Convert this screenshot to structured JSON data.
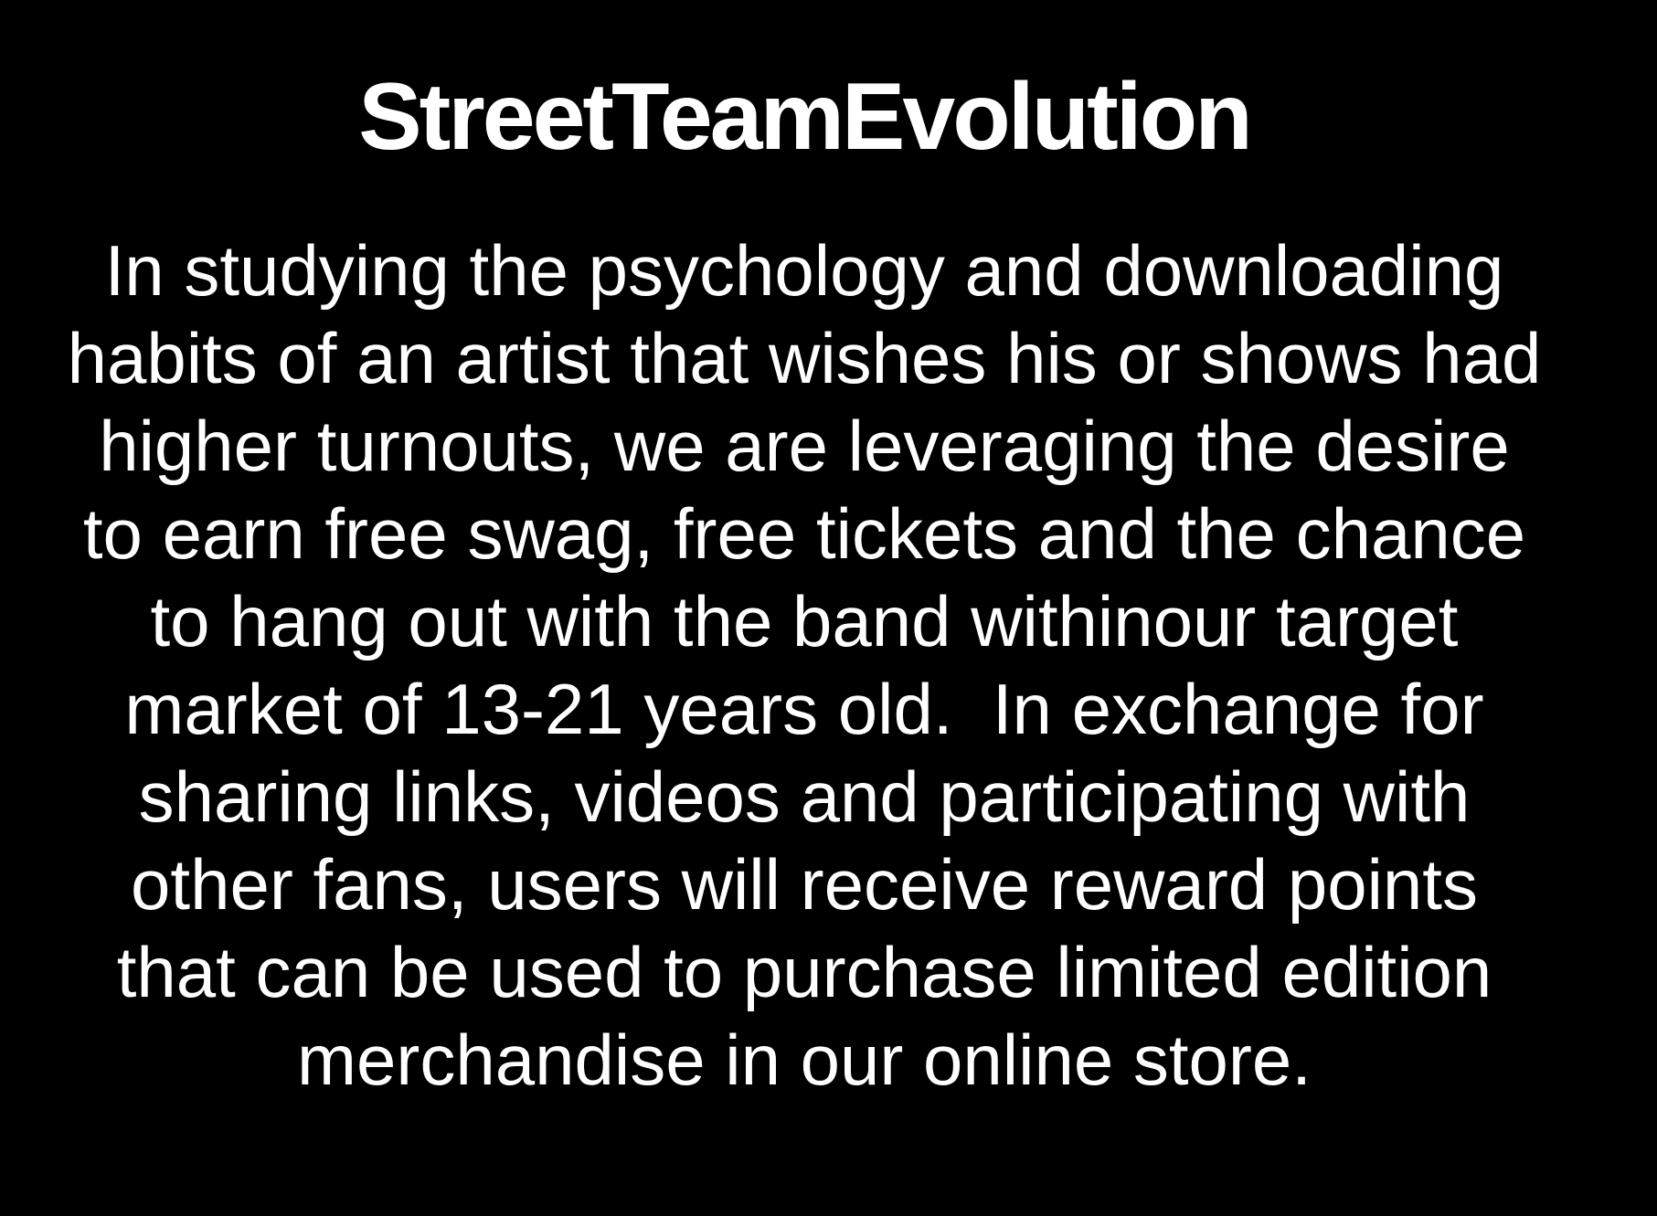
{
  "slide": {
    "title": "StreetTeamEvolution",
    "body_lines": [
      "In studying the psychology and downloading",
      "habits of an artist that wishes his or shows had",
      "higher turnouts, we are leveraging the desire",
      "to earn free swag, free tickets and the chance",
      "to hang out with the band withinour target",
      "market of 13-21 years old.  In exchange for",
      "sharing links, videos and participating with",
      "other fans, users will receive reward points",
      "that can be used to purchase limited edition",
      "merchandise in our online store."
    ]
  },
  "colors": {
    "background": "#000000",
    "text": "#ffffff"
  }
}
